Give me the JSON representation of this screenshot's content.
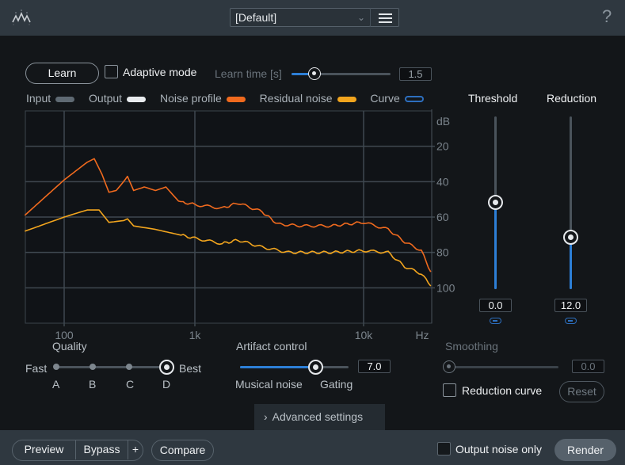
{
  "header": {
    "logo_icon": "waveform-logo-icon",
    "preset_value": "[Default]",
    "preset_menu_icon": "hamburger-menu-icon",
    "help_label": "?"
  },
  "learn_row": {
    "learn_label": "Learn",
    "adaptive_mode_label": "Adaptive mode",
    "adaptive_mode_checked": false,
    "learn_time_label": "Learn time [s]",
    "learn_time_value": "1.5",
    "learn_time_fraction": 0.23
  },
  "legend": [
    {
      "label": "Input",
      "color": "#5f6a73"
    },
    {
      "label": "Output",
      "color": "#e8ebee"
    },
    {
      "label": "Noise profile",
      "color": "#f06a1e"
    },
    {
      "label": "Residual noise",
      "color": "#f2a51e"
    },
    {
      "label": "Curve",
      "color": "#2d6fbf"
    }
  ],
  "chart_data": {
    "type": "line",
    "title": "",
    "xlabel": "Hz",
    "ylabel": "dB",
    "x_scale": "log",
    "x_ticks": [
      {
        "value": 100,
        "label": "100"
      },
      {
        "value": 1000,
        "label": "1k"
      },
      {
        "value": 10000,
        "label": "10k"
      }
    ],
    "y_ticks": [
      20,
      40,
      60,
      80,
      100
    ],
    "ylim": [
      0,
      120
    ],
    "y_inverted": true,
    "grid": true,
    "series": [
      {
        "name": "Noise profile",
        "color": "#f06a1e",
        "points": [
          [
            50,
            59
          ],
          [
            100,
            39
          ],
          [
            150,
            29
          ],
          [
            170,
            27
          ],
          [
            195,
            36
          ],
          [
            220,
            46
          ],
          [
            250,
            45
          ],
          [
            285,
            40
          ],
          [
            305,
            37
          ],
          [
            340,
            45
          ],
          [
            410,
            43
          ],
          [
            500,
            45
          ],
          [
            600,
            43
          ],
          [
            750,
            51
          ],
          [
            1000,
            53
          ],
          [
            1450,
            55
          ],
          [
            1800,
            52
          ],
          [
            2500,
            57
          ],
          [
            3100,
            64
          ],
          [
            4300,
            65
          ],
          [
            6400,
            65
          ],
          [
            10000,
            63
          ],
          [
            14000,
            67
          ],
          [
            17500,
            74
          ],
          [
            22000,
            79
          ],
          [
            25000,
            91
          ]
        ]
      },
      {
        "name": "Residual noise",
        "color": "#f2a51e",
        "points": [
          [
            50,
            68
          ],
          [
            100,
            60
          ],
          [
            150,
            56
          ],
          [
            185,
            56
          ],
          [
            220,
            63
          ],
          [
            285,
            62
          ],
          [
            305,
            61
          ],
          [
            340,
            65
          ],
          [
            500,
            67
          ],
          [
            1000,
            72
          ],
          [
            1450,
            75
          ],
          [
            1800,
            73
          ],
          [
            2500,
            77
          ],
          [
            3600,
            80
          ],
          [
            6400,
            80
          ],
          [
            10000,
            79
          ],
          [
            14000,
            80
          ],
          [
            17500,
            88
          ],
          [
            22000,
            92
          ],
          [
            25000,
            99
          ]
        ]
      }
    ]
  },
  "threshold": {
    "label": "Threshold",
    "value": "0.0",
    "fraction": 0.5,
    "link_icon": "link-icon"
  },
  "reduction": {
    "label": "Reduction",
    "value": "12.0",
    "fraction": 0.3,
    "link_icon": "link-icon"
  },
  "quality": {
    "label": "Quality",
    "left_label": "Fast",
    "right_label": "Best",
    "options": [
      "A",
      "B",
      "C",
      "D"
    ],
    "selected": "D"
  },
  "artifact": {
    "label": "Artifact control",
    "value": "7.0",
    "fraction": 0.7,
    "left_label": "Musical noise",
    "right_label": "Gating"
  },
  "smoothing": {
    "label": "Smoothing",
    "value": "0.0",
    "fraction": 0.0
  },
  "reduction_curve": {
    "label": "Reduction curve",
    "checked": false,
    "reset_label": "Reset"
  },
  "advanced": {
    "label": "Advanced settings",
    "icon": "chevron-right-icon"
  },
  "footer": {
    "preview_label": "Preview",
    "bypass_label": "Bypass",
    "plus_label": "+",
    "compare_label": "Compare",
    "output_noise_only_label": "Output noise only",
    "output_noise_only_checked": false,
    "render_label": "Render"
  }
}
